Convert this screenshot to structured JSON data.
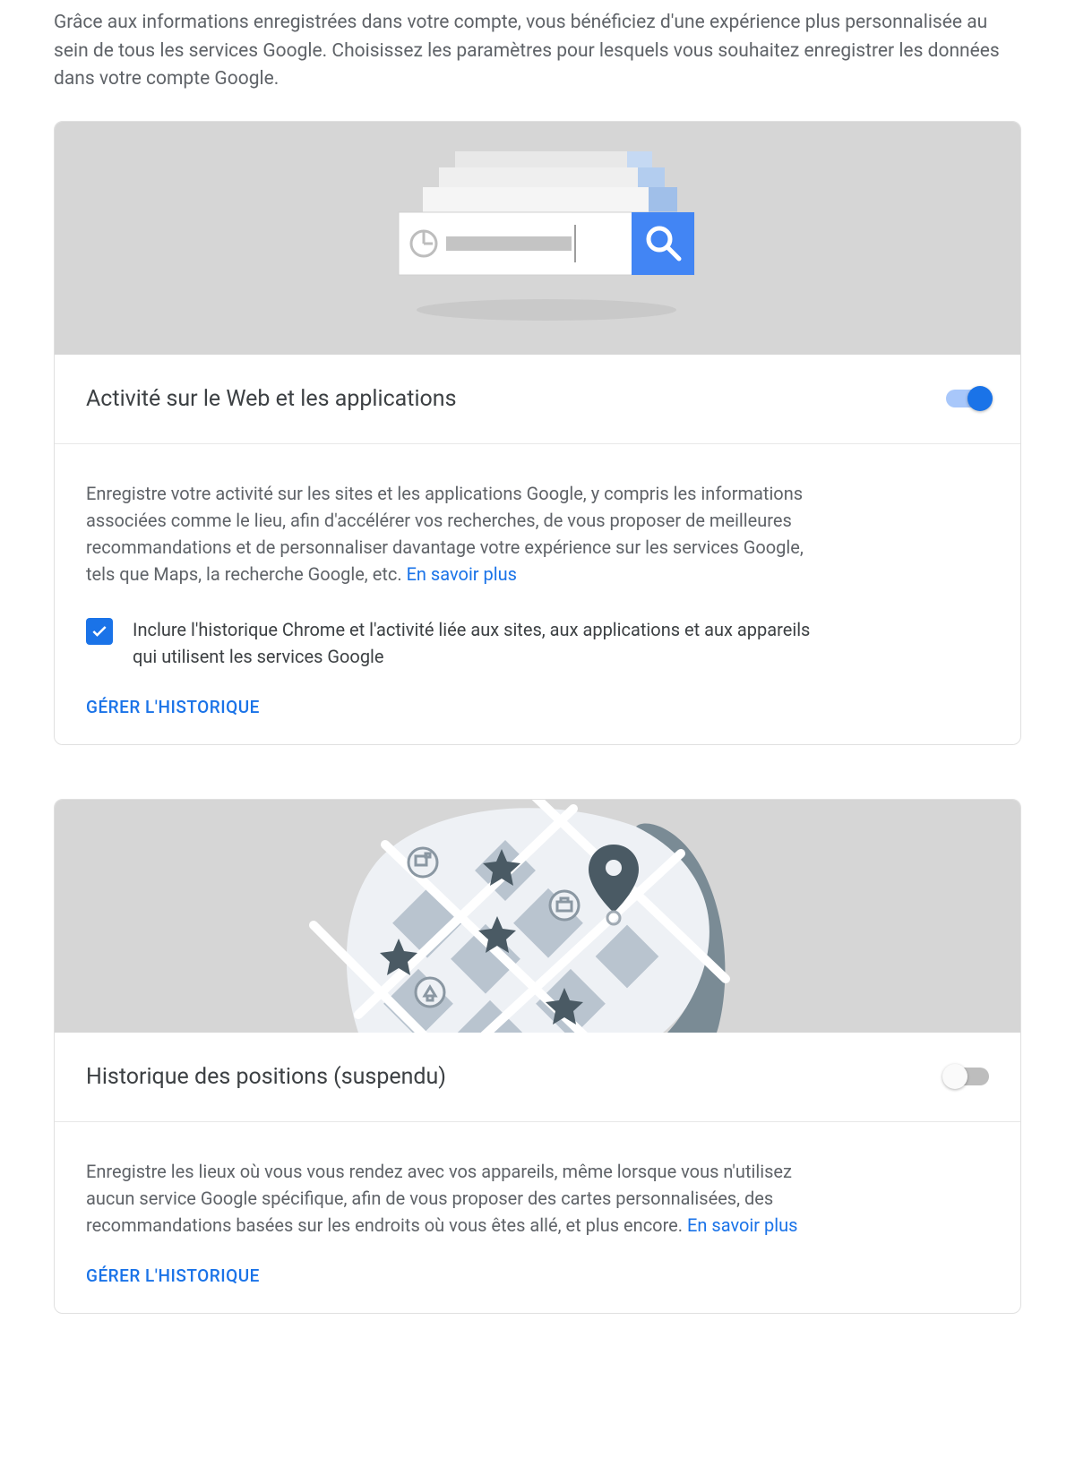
{
  "intro": "Grâce aux informations enregistrées dans votre compte, vous bénéficiez d'une expérience plus personnalisée au sein de tous les services Google. Choisissez les paramètres pour lesquels vous souhaitez enregistrer les données dans votre compte Google.",
  "card1": {
    "title": "Activité sur le Web et les applications",
    "toggle_on": true,
    "description": "Enregistre votre activité sur les sites et les applications Google, y compris les informations associées comme le lieu, afin d'accélérer vos recherches, de vous proposer de meilleures recommandations et de personnaliser davantage votre expérience sur les services Google, tels que Maps, la recherche Google, etc. ",
    "learn_more": "En savoir plus",
    "checkbox_label": "Inclure l'historique Chrome et l'activité liée aux sites, aux applications et aux appareils qui utilisent les services Google",
    "checkbox_checked": true,
    "action": "GÉRER L'HISTORIQUE"
  },
  "card2": {
    "title": "Historique des positions (suspendu)",
    "toggle_on": false,
    "description": "Enregistre les lieux où vous vous rendez avec vos appareils, même lorsque vous n'utilisez aucun service Google spécifique, afin de vous proposer des cartes personnalisées, des recommandations basées sur les endroits où vous êtes allé, et plus encore. ",
    "learn_more": "En savoir plus",
    "action": "GÉRER L'HISTORIQUE"
  }
}
